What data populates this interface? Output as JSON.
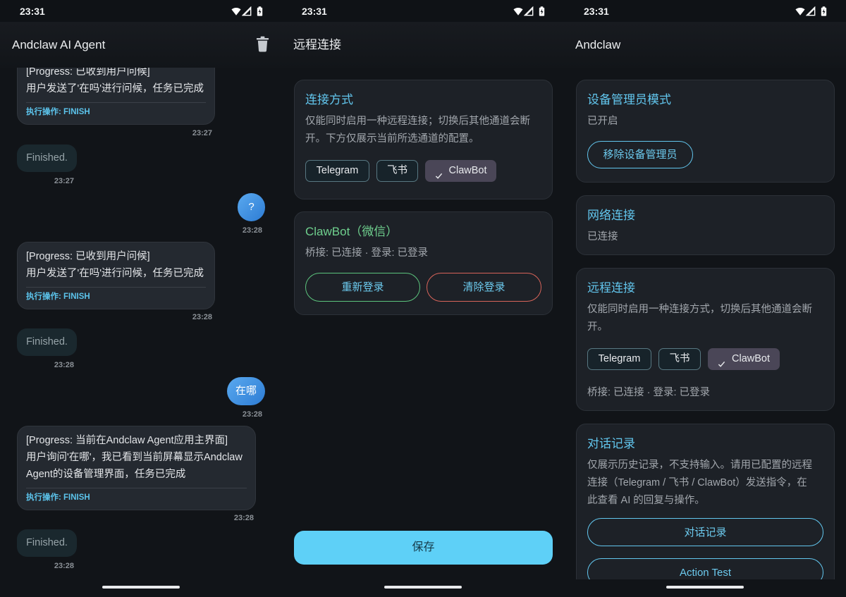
{
  "status_bar": {
    "time": "23:31",
    "icons": [
      "wifi-icon",
      "signal-icon",
      "battery-icon"
    ]
  },
  "icons": {
    "delete": "trash-icon",
    "check": "check-icon"
  },
  "colors": {
    "background": "#111418",
    "surface": "#1d2127",
    "surface_border": "#2c3138",
    "accent": "#62c6ee",
    "text_secondary": "#a2a7ad",
    "success": "#5cc47d",
    "success_text": "#6fd08e",
    "danger": "#d8645a",
    "primary_button": "#5ed0f7",
    "chip_selected": "#4a4657",
    "agent_bubble": "#242930",
    "status_bubble": "#1a282e"
  },
  "chat": {
    "title": "Andclaw AI Agent",
    "messages": [
      {
        "lines": [
          "[Progress: 已收到用户问候]",
          "用户发送了'在吗'进行问候，任务已完成"
        ],
        "action": "执行操作: FINISH",
        "time": "23:27"
      },
      {
        "text": "Finished.",
        "time": "23:27"
      },
      {
        "text": "?",
        "time": "23:28"
      },
      {
        "lines": [
          "[Progress: 已收到用户问候]",
          "用户发送了'在吗'进行问候，任务已完成"
        ],
        "action": "执行操作: FINISH",
        "time": "23:28"
      },
      {
        "text": "Finished.",
        "time": "23:28"
      },
      {
        "text": "在哪",
        "time": "23:28"
      },
      {
        "lines": [
          "[Progress: 当前在Andclaw Agent应用主界面]",
          "用户询问'在哪'，我已看到当前屏幕显示Andclaw",
          "Agent的设备管理界面，任务已完成"
        ],
        "action": "执行操作: FINISH",
        "time": "23:28"
      },
      {
        "text": "Finished.",
        "time": "23:28"
      }
    ]
  },
  "remote_screen": {
    "title": "远程连接",
    "connection_card": {
      "heading": "连接方式",
      "description_lines": [
        "仅能同时启用一种远程连接；切换后其他通道会断",
        "开。下方仅展示当前所选通道的配置。"
      ],
      "chips": [
        {
          "label": "Telegram",
          "selected": false
        },
        {
          "label": "飞书",
          "selected": false
        },
        {
          "label": "ClawBot",
          "selected": true
        }
      ]
    },
    "clawbot_card": {
      "heading": "ClawBot（微信）",
      "status": "桥接: 已连接 · 登录: 已登录",
      "relogin_label": "重新登录",
      "clear_login_label": "清除登录"
    },
    "save_label": "保存"
  },
  "home_screen": {
    "title": "Andclaw",
    "device_admin_card": {
      "heading": "设备管理员模式",
      "status": "已开启",
      "remove_label": "移除设备管理员"
    },
    "network_card": {
      "heading": "网络连接",
      "status": "已连接"
    },
    "remote_card": {
      "heading": "远程连接",
      "description_lines": [
        "仅能同时启用一种连接方式，切换后其他通道会断",
        "开。"
      ],
      "chips": [
        {
          "label": "Telegram",
          "selected": false
        },
        {
          "label": "飞书",
          "selected": false
        },
        {
          "label": "ClawBot",
          "selected": true
        }
      ],
      "status": "桥接: 已连接 · 登录: 已登录"
    },
    "history_card": {
      "heading": "对话记录",
      "description_lines": [
        "仅展示历史记录，不支持输入。请用已配置的远程",
        "连接（Telegram / 飞书 / ClawBot）发送指令，在",
        "此查看 AI 的回复与操作。"
      ],
      "history_label": "对话记录",
      "action_test_label": "Action Test"
    }
  }
}
